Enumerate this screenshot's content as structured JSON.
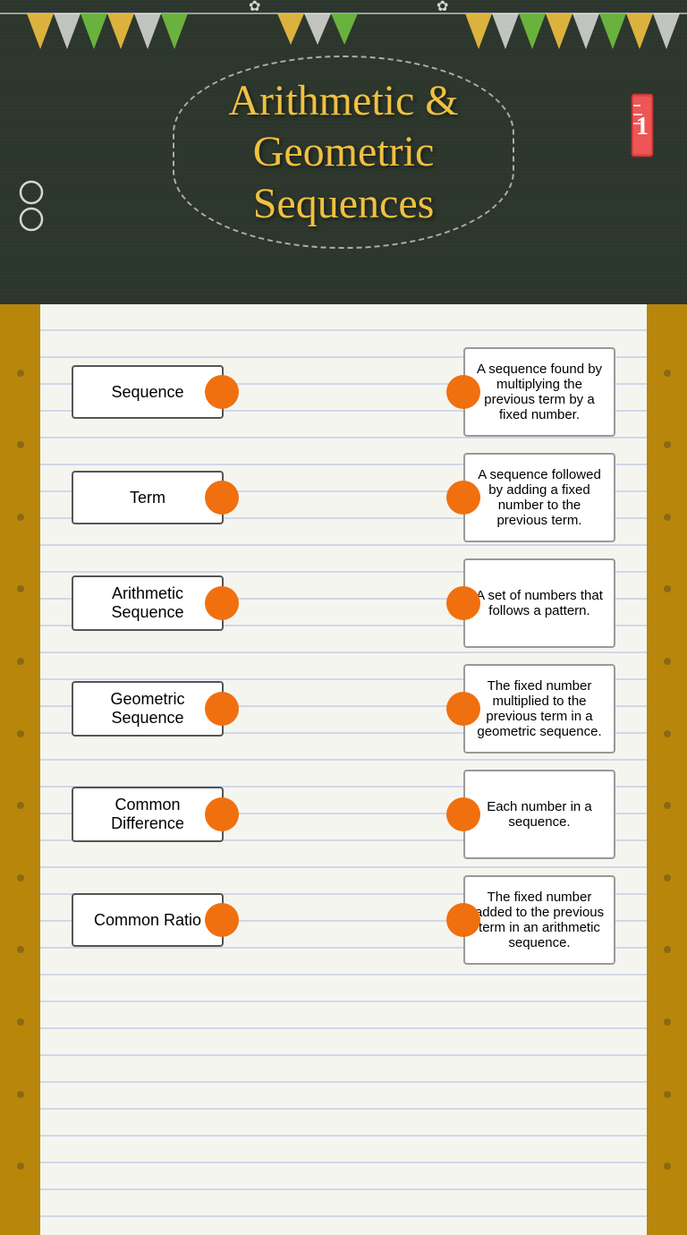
{
  "header": {
    "title_line1": "Arithmetic &",
    "title_line2": "Geometric",
    "title_line3": "Sequences"
  },
  "terms": [
    {
      "id": "sequence",
      "label": "Sequence"
    },
    {
      "id": "term",
      "label": "Term"
    },
    {
      "id": "arithmetic-sequence",
      "label": "Arithmetic Sequence"
    },
    {
      "id": "geometric-sequence",
      "label": "Geometric Sequence"
    },
    {
      "id": "common-difference",
      "label": "Common Difference"
    },
    {
      "id": "common-ratio",
      "label": "Common Ratio"
    }
  ],
  "definitions": [
    {
      "id": "def-geometric",
      "text": "A sequence found by multiplying the previous term by a fixed number."
    },
    {
      "id": "def-arithmetic",
      "text": "A sequence followed by adding a fixed number to the previous term."
    },
    {
      "id": "def-set",
      "text": "A set of numbers that follows a pattern."
    },
    {
      "id": "def-fixed-mult",
      "text": "The fixed number multiplied to the previous term in a geometric sequence."
    },
    {
      "id": "def-each-number",
      "text": "Each number in a sequence."
    },
    {
      "id": "def-fixed-add",
      "text": "The fixed number added to the previous term in an arithmetic sequence."
    }
  ]
}
